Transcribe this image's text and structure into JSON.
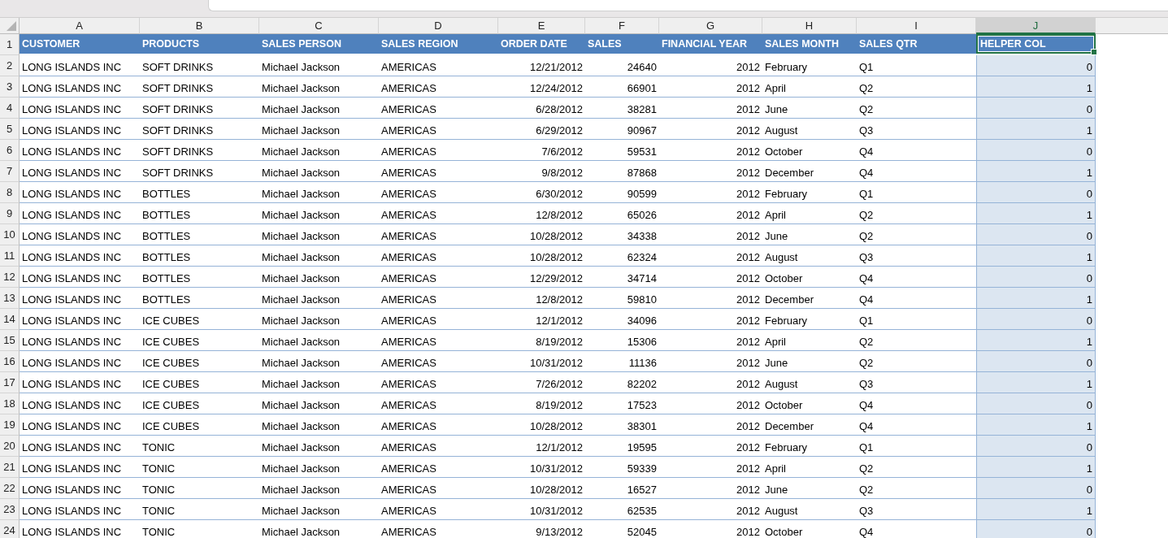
{
  "table": {
    "columns": [
      {
        "letter": "A",
        "kind": "text",
        "selected": false
      },
      {
        "letter": "B",
        "kind": "text",
        "selected": false
      },
      {
        "letter": "C",
        "kind": "text",
        "selected": false
      },
      {
        "letter": "D",
        "kind": "text",
        "selected": false
      },
      {
        "letter": "E",
        "kind": "number",
        "selected": false
      },
      {
        "letter": "F",
        "kind": "number",
        "selected": false
      },
      {
        "letter": "G",
        "kind": "number",
        "selected": false
      },
      {
        "letter": "H",
        "kind": "text",
        "selected": false
      },
      {
        "letter": "I",
        "kind": "text",
        "selected": false
      },
      {
        "letter": "J",
        "kind": "number",
        "selected": true
      }
    ],
    "header_row": {
      "number": "1",
      "cells": [
        "CUSTOMER",
        "PRODUCTS",
        "SALES PERSON",
        "SALES REGION",
        "ORDER DATE",
        "SALES",
        "FINANCIAL YEAR",
        "SALES MONTH",
        "SALES QTR",
        "HELPER COL"
      ]
    },
    "rows": [
      {
        "number": "2",
        "cells": [
          "LONG ISLANDS INC",
          "SOFT DRINKS",
          "Michael Jackson",
          "AMERICAS",
          "12/21/2012",
          "24640",
          "2012",
          "February",
          "Q1",
          "0"
        ]
      },
      {
        "number": "3",
        "cells": [
          "LONG ISLANDS INC",
          "SOFT DRINKS",
          "Michael Jackson",
          "AMERICAS",
          "12/24/2012",
          "66901",
          "2012",
          "April",
          "Q2",
          "1"
        ]
      },
      {
        "number": "4",
        "cells": [
          "LONG ISLANDS INC",
          "SOFT DRINKS",
          "Michael Jackson",
          "AMERICAS",
          "6/28/2012",
          "38281",
          "2012",
          "June",
          "Q2",
          "0"
        ]
      },
      {
        "number": "5",
        "cells": [
          "LONG ISLANDS INC",
          "SOFT DRINKS",
          "Michael Jackson",
          "AMERICAS",
          "6/29/2012",
          "90967",
          "2012",
          "August",
          "Q3",
          "1"
        ]
      },
      {
        "number": "6",
        "cells": [
          "LONG ISLANDS INC",
          "SOFT DRINKS",
          "Michael Jackson",
          "AMERICAS",
          "7/6/2012",
          "59531",
          "2012",
          "October",
          "Q4",
          "0"
        ]
      },
      {
        "number": "7",
        "cells": [
          "LONG ISLANDS INC",
          "SOFT DRINKS",
          "Michael Jackson",
          "AMERICAS",
          "9/8/2012",
          "87868",
          "2012",
          "December",
          "Q4",
          "1"
        ]
      },
      {
        "number": "8",
        "cells": [
          "LONG ISLANDS INC",
          "BOTTLES",
          "Michael Jackson",
          "AMERICAS",
          "6/30/2012",
          "90599",
          "2012",
          "February",
          "Q1",
          "0"
        ]
      },
      {
        "number": "9",
        "cells": [
          "LONG ISLANDS INC",
          "BOTTLES",
          "Michael Jackson",
          "AMERICAS",
          "12/8/2012",
          "65026",
          "2012",
          "April",
          "Q2",
          "1"
        ]
      },
      {
        "number": "10",
        "cells": [
          "LONG ISLANDS INC",
          "BOTTLES",
          "Michael Jackson",
          "AMERICAS",
          "10/28/2012",
          "34338",
          "2012",
          "June",
          "Q2",
          "0"
        ]
      },
      {
        "number": "11",
        "cells": [
          "LONG ISLANDS INC",
          "BOTTLES",
          "Michael Jackson",
          "AMERICAS",
          "10/28/2012",
          "62324",
          "2012",
          "August",
          "Q3",
          "1"
        ]
      },
      {
        "number": "12",
        "cells": [
          "LONG ISLANDS INC",
          "BOTTLES",
          "Michael Jackson",
          "AMERICAS",
          "12/29/2012",
          "34714",
          "2012",
          "October",
          "Q4",
          "0"
        ]
      },
      {
        "number": "13",
        "cells": [
          "LONG ISLANDS INC",
          "BOTTLES",
          "Michael Jackson",
          "AMERICAS",
          "12/8/2012",
          "59810",
          "2012",
          "December",
          "Q4",
          "1"
        ]
      },
      {
        "number": "14",
        "cells": [
          "LONG ISLANDS INC",
          "ICE CUBES",
          "Michael Jackson",
          "AMERICAS",
          "12/1/2012",
          "34096",
          "2012",
          "February",
          "Q1",
          "0"
        ]
      },
      {
        "number": "15",
        "cells": [
          "LONG ISLANDS INC",
          "ICE CUBES",
          "Michael Jackson",
          "AMERICAS",
          "8/19/2012",
          "15306",
          "2012",
          "April",
          "Q2",
          "1"
        ]
      },
      {
        "number": "16",
        "cells": [
          "LONG ISLANDS INC",
          "ICE CUBES",
          "Michael Jackson",
          "AMERICAS",
          "10/31/2012",
          "11136",
          "2012",
          "June",
          "Q2",
          "0"
        ]
      },
      {
        "number": "17",
        "cells": [
          "LONG ISLANDS INC",
          "ICE CUBES",
          "Michael Jackson",
          "AMERICAS",
          "7/26/2012",
          "82202",
          "2012",
          "August",
          "Q3",
          "1"
        ]
      },
      {
        "number": "18",
        "cells": [
          "LONG ISLANDS INC",
          "ICE CUBES",
          "Michael Jackson",
          "AMERICAS",
          "8/19/2012",
          "17523",
          "2012",
          "October",
          "Q4",
          "0"
        ]
      },
      {
        "number": "19",
        "cells": [
          "LONG ISLANDS INC",
          "ICE CUBES",
          "Michael Jackson",
          "AMERICAS",
          "10/28/2012",
          "38301",
          "2012",
          "December",
          "Q4",
          "1"
        ]
      },
      {
        "number": "20",
        "cells": [
          "LONG ISLANDS INC",
          "TONIC",
          "Michael Jackson",
          "AMERICAS",
          "12/1/2012",
          "19595",
          "2012",
          "February",
          "Q1",
          "0"
        ]
      },
      {
        "number": "21",
        "cells": [
          "LONG ISLANDS INC",
          "TONIC",
          "Michael Jackson",
          "AMERICAS",
          "10/31/2012",
          "59339",
          "2012",
          "April",
          "Q2",
          "1"
        ]
      },
      {
        "number": "22",
        "cells": [
          "LONG ISLANDS INC",
          "TONIC",
          "Michael Jackson",
          "AMERICAS",
          "10/28/2012",
          "16527",
          "2012",
          "June",
          "Q2",
          "0"
        ]
      },
      {
        "number": "23",
        "cells": [
          "LONG ISLANDS INC",
          "TONIC",
          "Michael Jackson",
          "AMERICAS",
          "10/31/2012",
          "62535",
          "2012",
          "August",
          "Q3",
          "1"
        ]
      },
      {
        "number": "24",
        "cells": [
          "LONG ISLANDS INC",
          "TONIC",
          "Michael Jackson",
          "AMERICAS",
          "9/13/2012",
          "52045",
          "2012",
          "October",
          "Q4",
          "0"
        ]
      }
    ]
  }
}
